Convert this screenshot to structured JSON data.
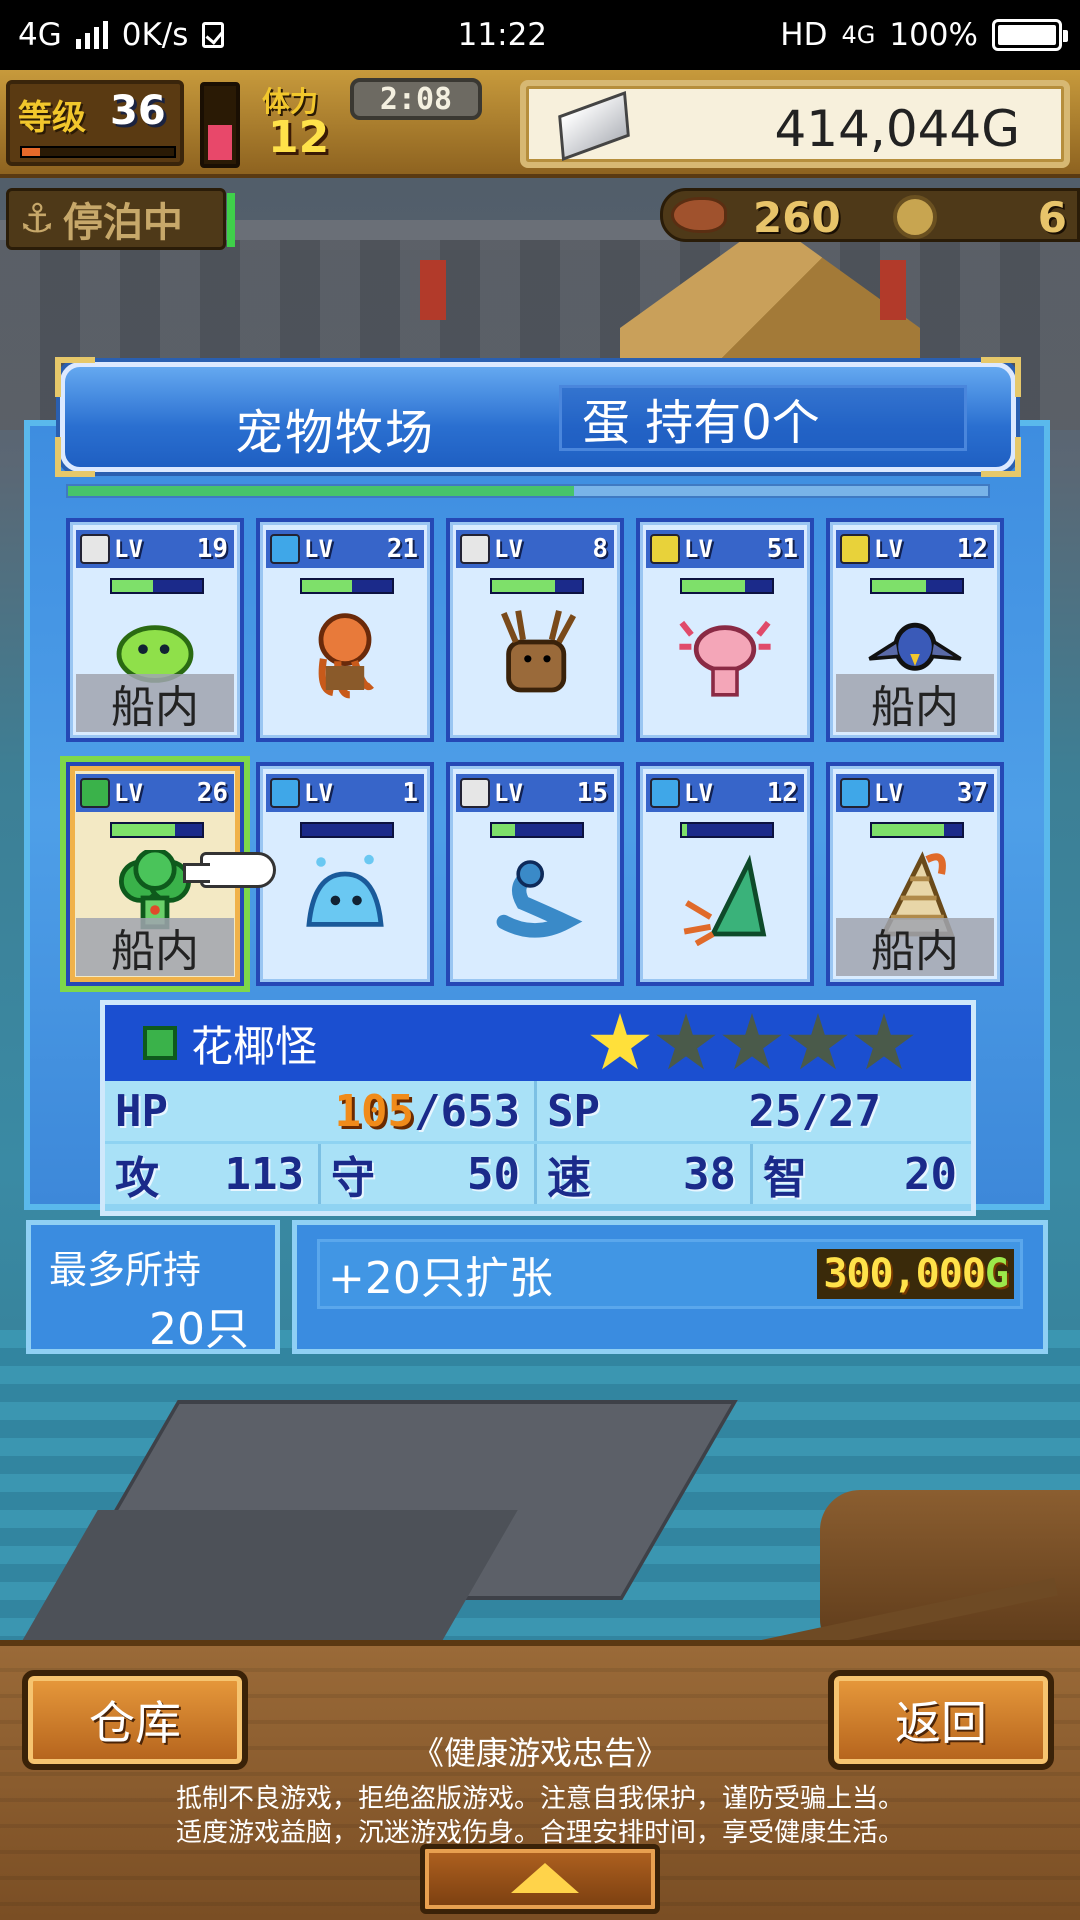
{
  "status_bar": {
    "network": "4G",
    "speed": "0K/s",
    "time": "11:22",
    "hd": "HD",
    "network_right": "4G",
    "battery": "100%"
  },
  "hud": {
    "level_label": "等级",
    "level": "36",
    "level_progress": 0.12,
    "stamina_vial_fill": 0.45,
    "stamina_label": "体力",
    "stamina": "12",
    "timer": "2:08",
    "gold": "414,044G",
    "status": "停泊中",
    "resource_meat": "260",
    "resource_coin": "6"
  },
  "dialog": {
    "title": "宠物牧场",
    "eggs": "蛋 持有0个",
    "progress": 0.55
  },
  "pets": [
    {
      "level": "19",
      "element": "#e6e6e6",
      "hp": 0.45,
      "onboard": "船内",
      "sprite": "slime",
      "selected": false
    },
    {
      "level": "21",
      "element": "#3fa7e8",
      "hp": 0.55,
      "onboard": "",
      "sprite": "octopus",
      "selected": false
    },
    {
      "level": "8",
      "element": "#e6e6e6",
      "hp": 0.7,
      "onboard": "",
      "sprite": "deer",
      "selected": false
    },
    {
      "level": "51",
      "element": "#e8d23a",
      "hp": 0.7,
      "onboard": "",
      "sprite": "axolotl",
      "selected": false
    },
    {
      "level": "12",
      "element": "#e8d23a",
      "hp": 0.6,
      "onboard": "船内",
      "sprite": "bird",
      "selected": false
    },
    {
      "level": "26",
      "element": "#3ab24a",
      "hp": 0.7,
      "onboard": "船内",
      "sprite": "broccoli",
      "selected": true
    },
    {
      "level": "1",
      "element": "#3fa7e8",
      "hp": 0.0,
      "onboard": "",
      "sprite": "blob",
      "selected": false
    },
    {
      "level": "15",
      "element": "#e6e6e6",
      "hp": 0.25,
      "onboard": "",
      "sprite": "snake",
      "selected": false
    },
    {
      "level": "12",
      "element": "#3fa7e8",
      "hp": 0.05,
      "onboard": "",
      "sprite": "hermit",
      "selected": false
    },
    {
      "level": "37",
      "element": "#3fa7e8",
      "hp": 0.8,
      "onboard": "船内",
      "sprite": "shell",
      "selected": false
    }
  ],
  "lv_tag": "LV",
  "selected_pet": {
    "name": "花椰怪",
    "stars": 1,
    "stars_max": 5,
    "hp_label": "HP",
    "hp_current": "105",
    "hp_max": "/653",
    "sp_label": "SP",
    "sp": "25/27",
    "atk_label": "攻",
    "atk": "113",
    "def_label": "守",
    "def": "50",
    "spd_label": "速",
    "spd": "38",
    "int_label": "智",
    "int": "20"
  },
  "capacity": {
    "label": "最多所持",
    "value": "20只"
  },
  "expand": {
    "label": "+20只扩张",
    "price": "300,000",
    "currency": "G"
  },
  "bottom": {
    "warehouse": "仓库",
    "back": "返回",
    "notice_title": "《健康游戏忠告》",
    "notice_line1": "抵制不良游戏，拒绝盗版游戏。注意自我保护，谨防受骗上当。",
    "notice_line2": "适度游戏益脑，沉迷游戏伤身。合理安排时间，享受健康生活。"
  },
  "colors": {
    "star_on": "#ffe03a",
    "star_off": "#4a5a4a"
  }
}
